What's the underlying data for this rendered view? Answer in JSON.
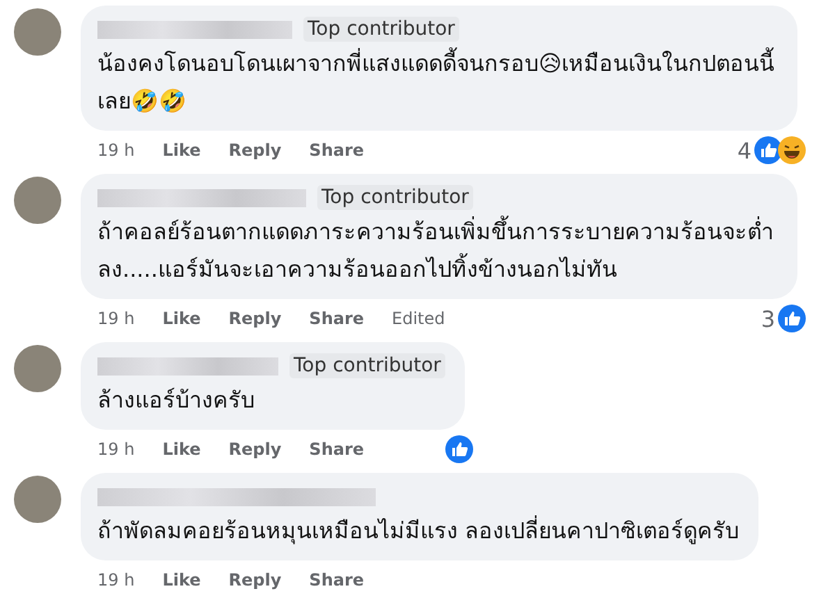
{
  "comments": [
    {
      "badge": "Top contributor",
      "text": "น้องคงโดนอบโดนเผาจากพี่แสงแดดดี้จนกรอบ😥เหมือนเงินในกปตอนนี้เลย🤣🤣",
      "time": "19 h",
      "actions": [
        "Like",
        "Reply",
        "Share"
      ],
      "reaction_count": "4",
      "reactions": [
        {
          "kind": "like"
        },
        {
          "kind": "haha"
        }
      ]
    },
    {
      "badge": "Top contributor",
      "text": "ถ้าคอลย์ร้อนตากแดดภาระความร้อนเพิ่มขึ้นการระบายความร้อนจะต่ำลง.....แอร์มันจะเอาความร้อนออกไปทิ้งข้างนอกไม่ทัน",
      "time": "19 h",
      "actions": [
        "Like",
        "Reply",
        "Share"
      ],
      "edited": "Edited",
      "reaction_count": "3",
      "reactions": [
        {
          "kind": "like"
        }
      ]
    },
    {
      "badge": "Top contributor",
      "text": "ล้างแอร์บ้างครับ",
      "time": "19 h",
      "actions": [
        "Like",
        "Reply",
        "Share"
      ],
      "reactions": [
        {
          "kind": "like"
        }
      ]
    },
    {
      "text": "ถ้าพัดลมคอยร้อนหมุนเหมือนไม่มีแรง ลองเปลี่ยนคาปาซิเตอร์ดูครับ",
      "time": "19 h",
      "actions": [
        "Like",
        "Reply",
        "Share"
      ]
    }
  ]
}
